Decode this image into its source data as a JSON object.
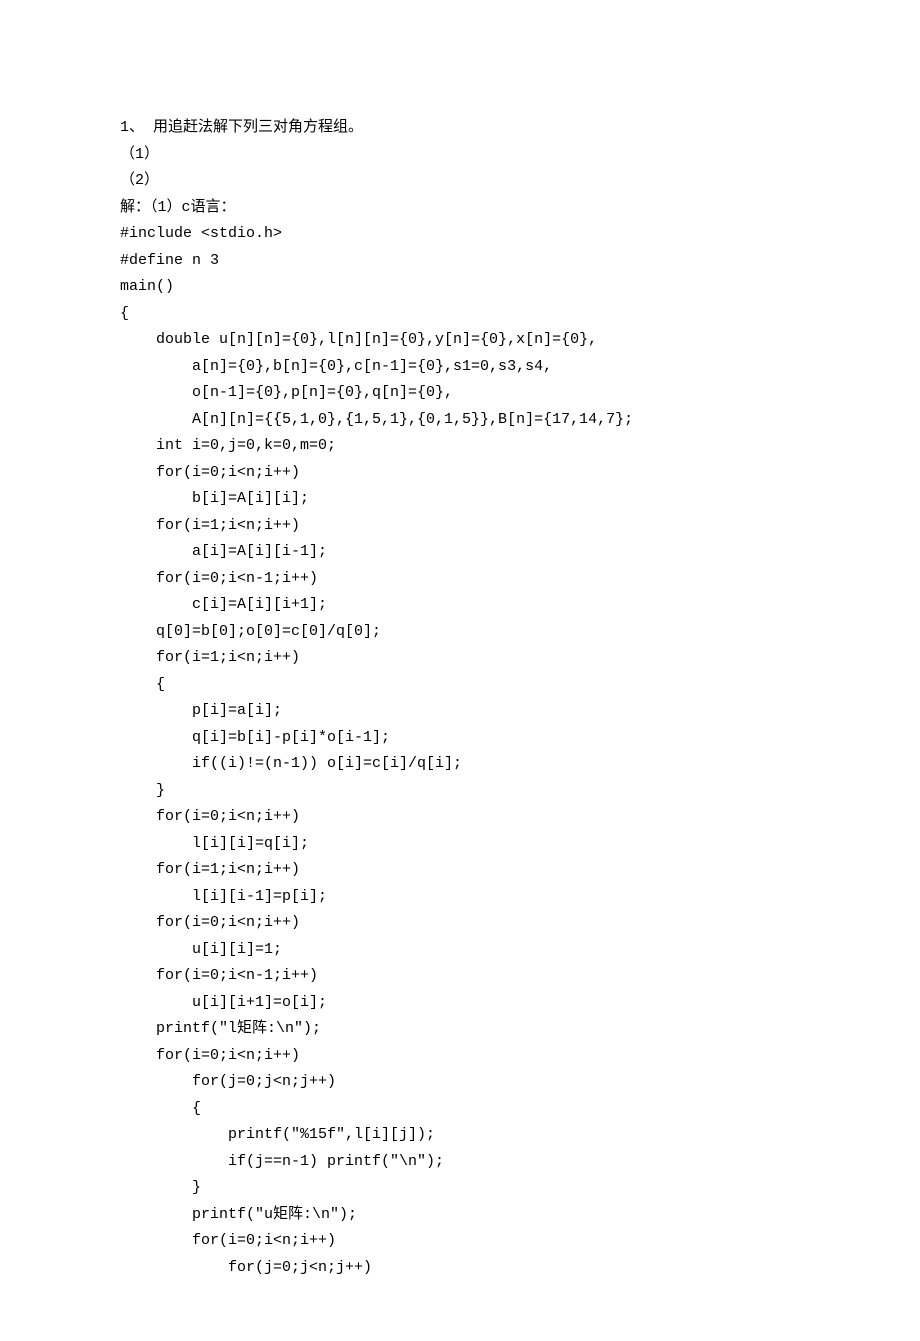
{
  "lines": [
    "1、 用追赶法解下列三对角方程组。",
    "（1）",
    "（2）",
    "解：（1）c语言：",
    "#include <stdio.h>",
    "#define n 3",
    "main()",
    "{",
    "    double u[n][n]={0},l[n][n]={0},y[n]={0},x[n]={0},",
    "        a[n]={0},b[n]={0},c[n-1]={0},s1=0,s3,s4,",
    "        o[n-1]={0},p[n]={0},q[n]={0},",
    "        A[n][n]={{5,1,0},{1,5,1},{0,1,5}},B[n]={17,14,7};",
    "    int i=0,j=0,k=0,m=0;",
    "    for(i=0;i<n;i++)",
    "        b[i]=A[i][i];",
    "    for(i=1;i<n;i++)",
    "        a[i]=A[i][i-1];",
    "    for(i=0;i<n-1;i++)",
    "        c[i]=A[i][i+1];",
    "    q[0]=b[0];o[0]=c[0]/q[0];",
    "    for(i=1;i<n;i++)",
    "    {",
    "        p[i]=a[i];",
    "        q[i]=b[i]-p[i]*o[i-1];",
    "        if((i)!=(n-1)) o[i]=c[i]/q[i];",
    "    }",
    "    for(i=0;i<n;i++)",
    "        l[i][i]=q[i];",
    "    for(i=1;i<n;i++)",
    "        l[i][i-1]=p[i];",
    "    for(i=0;i<n;i++)",
    "        u[i][i]=1;",
    "    for(i=0;i<n-1;i++)",
    "        u[i][i+1]=o[i];",
    "    printf(\"l矩阵:\\n\");",
    "    for(i=0;i<n;i++)",
    "        for(j=0;j<n;j++)",
    "        {",
    "            printf(\"%15f\",l[i][j]);",
    "            if(j==n-1) printf(\"\\n\");",
    "        }",
    "        printf(\"u矩阵:\\n\");",
    "        for(i=0;i<n;i++)",
    "            for(j=0;j<n;j++)"
  ]
}
